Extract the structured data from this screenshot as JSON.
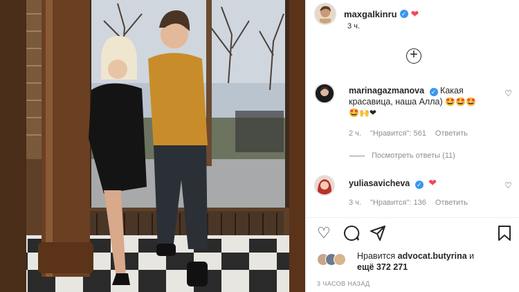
{
  "post": {
    "author": "maxgalkinru",
    "time": "3 ч."
  },
  "comments": [
    {
      "user": "marinagazmanova",
      "text": "Какая красавица, наша Алла)",
      "emojis_inline": "🤩🤩🤩",
      "emojis_line2": "🤩🙌❤",
      "time": "2 ч.",
      "likes": "\"Нравится\": 561",
      "reply": "Ответить"
    },
    {
      "user": "yuliasavicheva",
      "text": "",
      "emojis_inline": "❤",
      "time": "3 ч.",
      "likes": "\"Нравится\": 136",
      "reply": "Ответить"
    }
  ],
  "view_replies": "Посмотреть ответы (11)",
  "likes": {
    "prefix": "Нравится",
    "user": "advocat.butyrina",
    "and": "и",
    "more": "ещё 372 271"
  },
  "posted_ago": "3 ЧАСОВ НАЗАД",
  "icons": {
    "like": "heart-outline-icon",
    "comment": "comment-bubble-icon",
    "share": "paper-plane-icon",
    "save": "bookmark-icon",
    "add": "plus-circle-icon",
    "verified": "verified-badge-icon"
  },
  "colors": {
    "verified": "#3897f0",
    "heart": "#ed4956",
    "muted": "#8e8e8e"
  }
}
